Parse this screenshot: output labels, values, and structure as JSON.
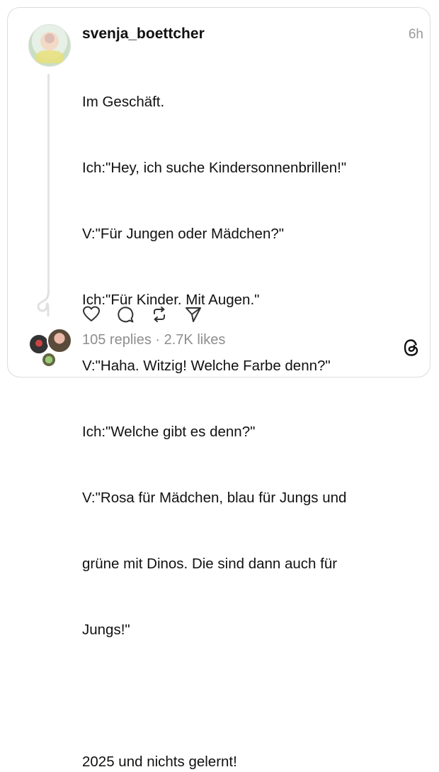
{
  "post": {
    "username": "svenja_boettcher",
    "time": "6h",
    "lines": [
      "Im Geschäft.",
      "Ich:\"Hey, ich suche Kindersonnenbrillen!\"",
      "V:\"Für Jungen oder Mädchen?\"",
      "Ich:\"Für Kinder. Mit Augen.\"",
      "V:\"Haha. Witzig! Welche Farbe denn?\"",
      "Ich:\"Welche gibt es denn?\"",
      "V:\"Rosa für Mädchen, blau für Jungs und",
      "grüne mit Dinos. Die sind dann auch für",
      "Jungs!\"",
      "",
      "2025 und nichts gelernt!"
    ],
    "stats": "105 replies · 2.7K likes"
  },
  "icons": {
    "like": "heart-icon",
    "reply": "comment-icon",
    "repost": "repost-icon",
    "share": "send-icon",
    "brand": "threads-logo"
  },
  "colors": {
    "text": "#111111",
    "muted": "#8e8e8e",
    "border": "#dcdcdc"
  }
}
